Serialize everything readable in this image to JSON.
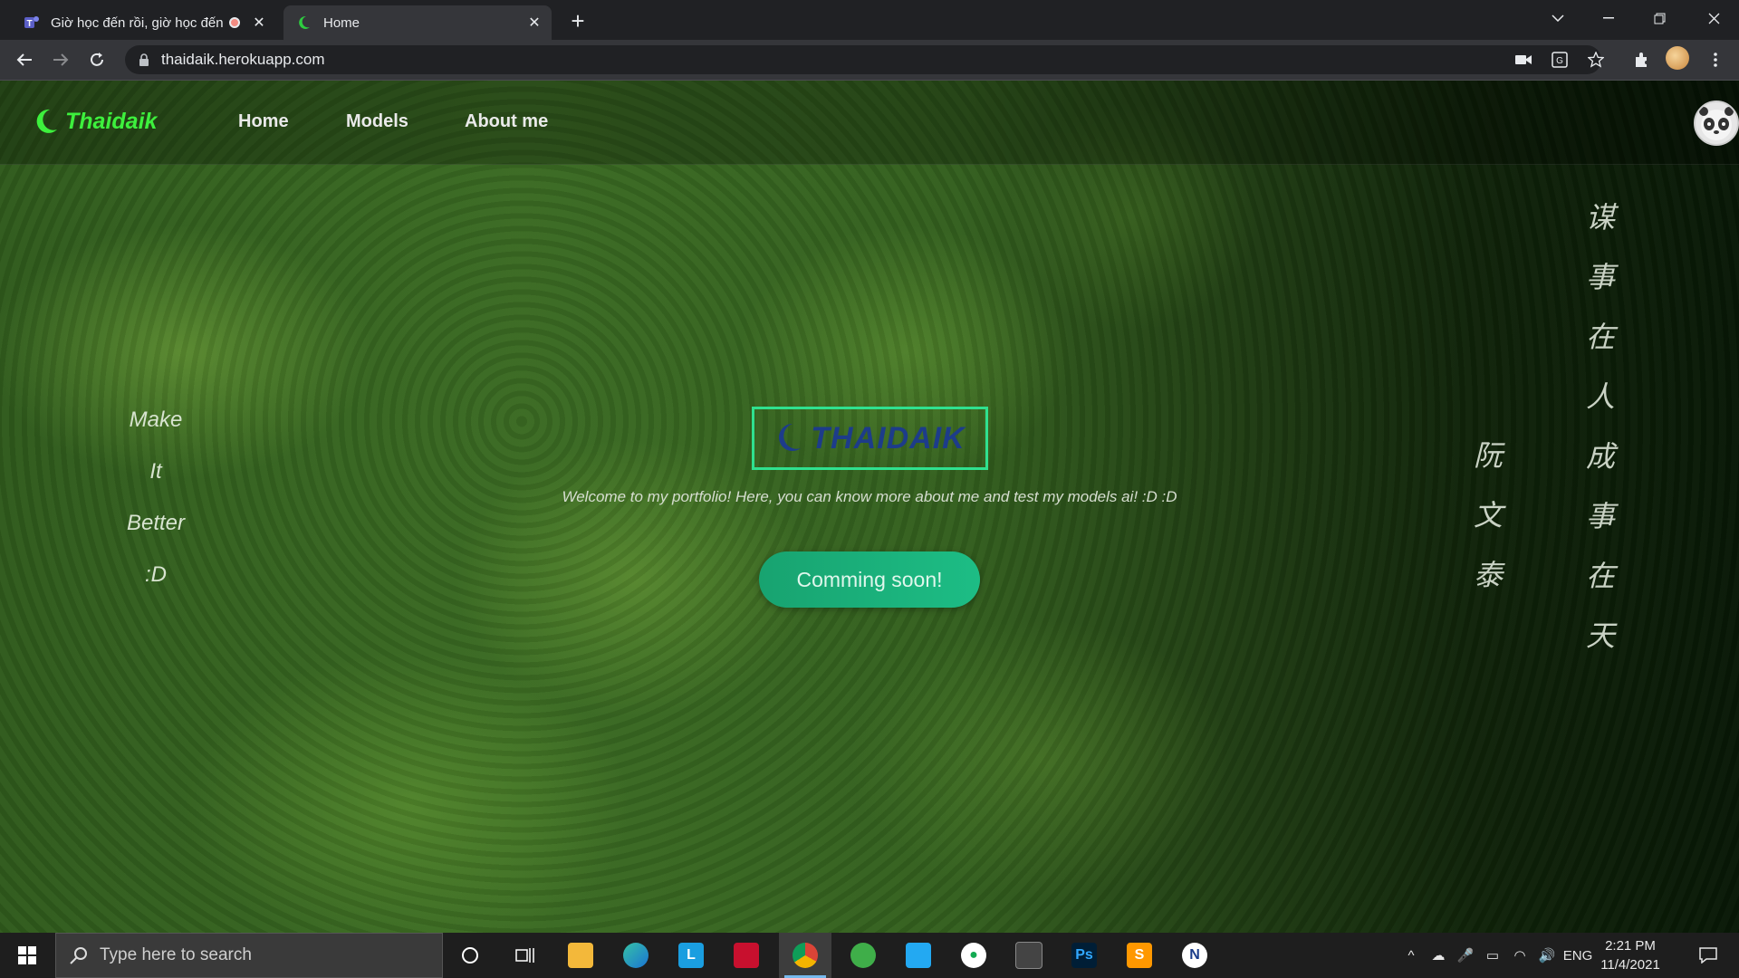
{
  "browser": {
    "tabs": [
      {
        "title": "Giờ học đến rồi, giờ học đến",
        "active": false
      },
      {
        "title": "Home",
        "active": true
      }
    ],
    "url": "thaidaik.herokuapp.com"
  },
  "site": {
    "brand": "Thaidaik",
    "nav": [
      {
        "label": "Home"
      },
      {
        "label": "Models"
      },
      {
        "label": "About me"
      }
    ],
    "left_words": [
      "Make",
      "It",
      "Better",
      ":D"
    ],
    "cjk_right": [
      "谋",
      "事",
      "在",
      "人",
      "成",
      "事",
      "在",
      "天"
    ],
    "cjk_left": [
      "阮",
      "文",
      "泰"
    ],
    "logo_text": "THAIDAIK",
    "welcome": "Welcome to my portfolio! Here, you can know more about me and test my models ai! :D :D",
    "cta": "Comming soon!",
    "colors": {
      "brand": "#3df03d",
      "accent": "#1dbd85",
      "logo": "#1d3c8a"
    }
  },
  "taskbar": {
    "search_placeholder": "Type here to search",
    "lang": "ENG",
    "time": "2:21 PM",
    "date": "11/4/2021",
    "icons": [
      "cortana-icon",
      "task-view-icon",
      "file-explorer-icon",
      "edge-icon",
      "l-app-icon",
      "mcafee-icon",
      "chrome-icon",
      "clean-icon",
      "vscode-icon",
      "mongodb-icon",
      "terminal-icon",
      "photoshop-icon",
      "sublime-icon",
      "app-icon"
    ]
  }
}
